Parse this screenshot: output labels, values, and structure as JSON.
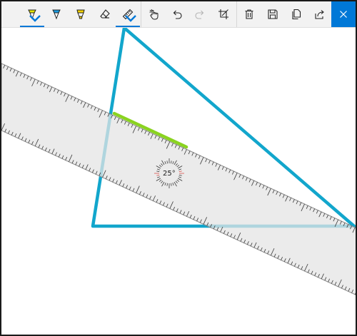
{
  "toolbar": {
    "tools": [
      {
        "id": "ballpoint-pen",
        "icon": "ballpoint-pen-icon",
        "color": "#e3e600",
        "selected": true
      },
      {
        "id": "pencil",
        "icon": "pencil-icon",
        "color": "#1a9be0",
        "selected": false
      },
      {
        "id": "highlighter",
        "icon": "highlighter-icon",
        "color": "#f2d100",
        "selected": false
      },
      {
        "id": "eraser",
        "icon": "eraser-icon",
        "selected": false
      },
      {
        "id": "ruler",
        "icon": "ruler-icon",
        "selected": true
      }
    ],
    "actions": [
      {
        "id": "touch-writing",
        "icon": "touch-writing-icon"
      },
      {
        "id": "undo",
        "icon": "undo-icon"
      },
      {
        "id": "redo",
        "icon": "redo-icon",
        "disabled": true
      },
      {
        "id": "crop",
        "icon": "crop-icon"
      },
      {
        "id": "delete",
        "icon": "trash-icon"
      },
      {
        "id": "save",
        "icon": "save-icon"
      },
      {
        "id": "copy",
        "icon": "copy-icon"
      },
      {
        "id": "share",
        "icon": "share-icon"
      }
    ],
    "close_icon": "close-icon"
  },
  "ruler": {
    "angle_label": "25°",
    "angle_degrees": 25
  },
  "colors": {
    "accent": "#0078d7",
    "ink_blue": "#12a6cc",
    "ink_green": "#8ad320",
    "ruler_fill": "#e6e6e6",
    "toolbar_bg": "#f2f2f2"
  }
}
